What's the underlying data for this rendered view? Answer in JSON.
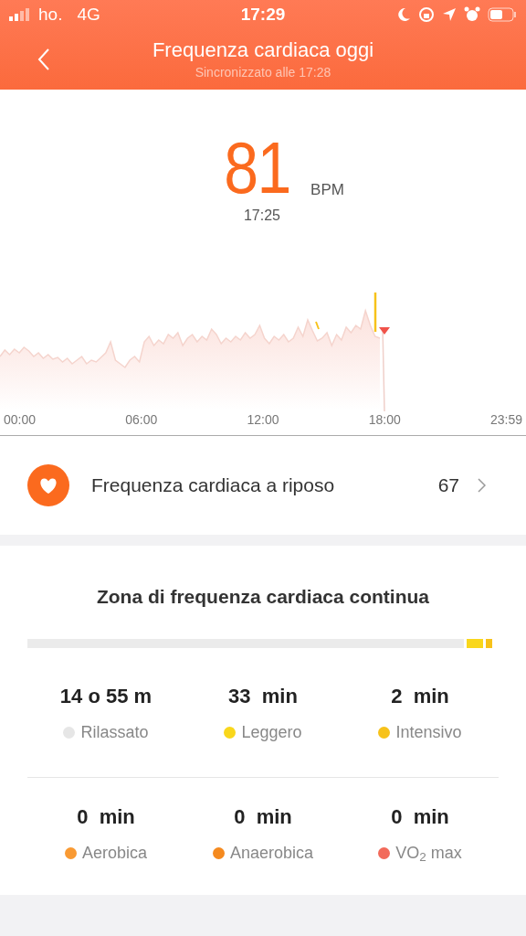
{
  "status_bar": {
    "carrier": "ho.",
    "network": "4G",
    "time": "17:29"
  },
  "header": {
    "title": "Frequenza cardiaca oggi",
    "subtitle": "Sincronizzato alle 17:28"
  },
  "current": {
    "value": "81",
    "unit": "BPM",
    "time": "17:25"
  },
  "chart": {
    "x_labels": [
      "00:00",
      "06:00",
      "12:00",
      "18:00",
      "23:59"
    ]
  },
  "resting": {
    "label": "Frequenza cardiaca a riposo",
    "value": "67"
  },
  "zones": {
    "title": "Zona di frequenza cardiaca continua",
    "items": [
      {
        "value": "14 o 55 m",
        "label": "Rilassato",
        "color": "#e6e6e6"
      },
      {
        "value": "33  min",
        "label": "Leggero",
        "color": "#f9d71c"
      },
      {
        "value": "2  min",
        "label": "Intensivo",
        "color": "#f7c21a"
      },
      {
        "value": "0  min",
        "label": "Aerobica",
        "color": "#f99a33"
      },
      {
        "value": "0  min",
        "label": "Anaerobica",
        "color": "#f58a1f"
      },
      {
        "value": "0  min",
        "label": "VO$_{2}$ max",
        "color": "#f26a5a"
      }
    ]
  }
}
